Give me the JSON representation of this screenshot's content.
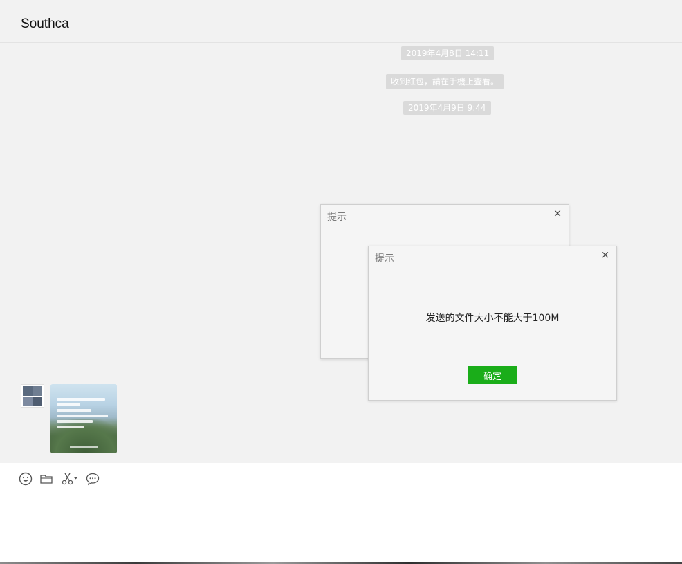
{
  "header": {
    "title": "Southca"
  },
  "messages": {
    "time1": "2019年4月8日 14:11",
    "notice": "收到红包，請在手機上查看。",
    "time2": "2019年4月9日 9:44"
  },
  "dialog_back": {
    "title": "提示",
    "close": "×"
  },
  "dialog_front": {
    "title": "提示",
    "close": "×",
    "message": "发送的文件大小不能大于100M",
    "ok_label": "确定"
  },
  "toolbar": {
    "icons": [
      "emoji-icon",
      "folder-icon",
      "scissors-icon",
      "chat-bubble-icon"
    ]
  },
  "colors": {
    "accent_green": "#1aad19",
    "background": "#f2f2f2",
    "system_bubble": "#dadada"
  }
}
